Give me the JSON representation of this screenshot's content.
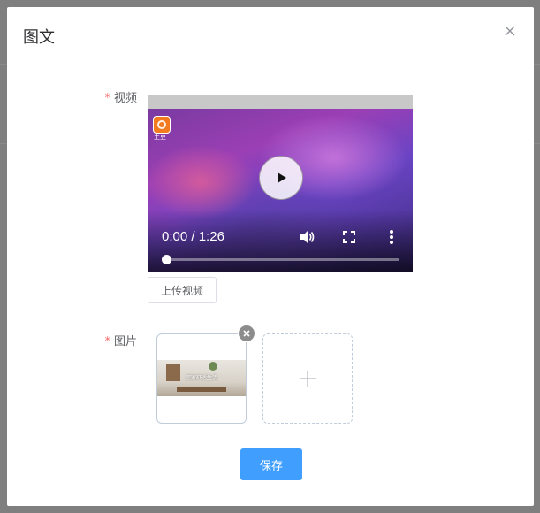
{
  "dialog": {
    "title": "图文",
    "close_icon": "close-icon"
  },
  "form": {
    "required_mark": "*",
    "video": {
      "label": "视频",
      "player": {
        "current_time": "0:00",
        "separator": "/",
        "duration": "1:26",
        "progress_fraction": 0.0,
        "watermark_text": "土豆",
        "icons": [
          "play-icon",
          "volume-icon",
          "fullscreen-icon",
          "more-options-icon",
          "tudou-logo-icon"
        ]
      },
      "upload_button": "上传视频"
    },
    "image": {
      "label": "图片",
      "thumbnail_caption": "您家舒适生活",
      "icons": [
        "remove-icon",
        "plus-icon"
      ]
    },
    "save_button": "保存"
  },
  "colors": {
    "primary": "#409eff",
    "required": "#f56c6c",
    "border": "#c0ccda"
  }
}
